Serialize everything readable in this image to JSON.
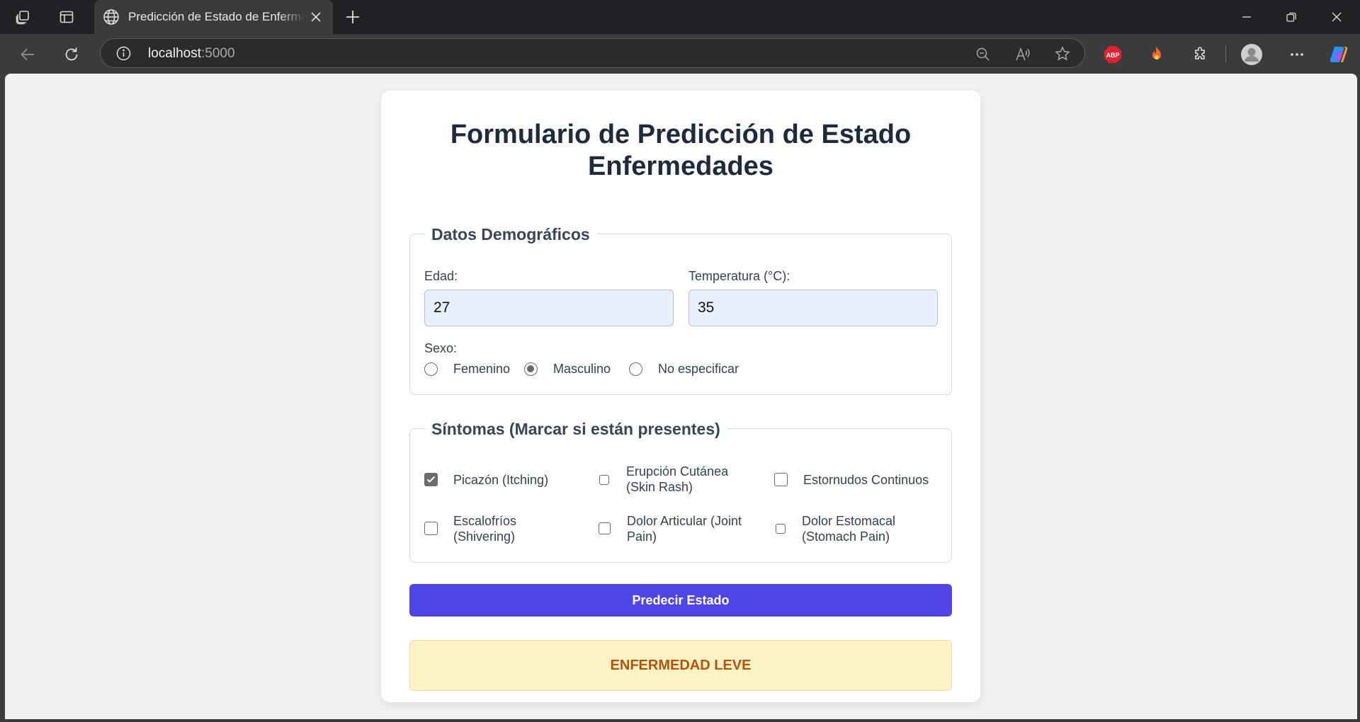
{
  "browser": {
    "tab_title": "Predicción de Estado de Enfermedades",
    "url_host": "localhost",
    "url_port": ":5000",
    "icons": [
      "workspaces-icon",
      "tab-actions-icon",
      "globe-icon",
      "close-icon",
      "new-tab-icon",
      "minimize-icon",
      "restore-icon",
      "window-close-icon",
      "back-icon",
      "refresh-icon",
      "site-info-icon",
      "zoom-out-icon",
      "read-aloud-icon",
      "favorite-icon",
      "adblock-icon",
      "extension-fire-icon",
      "extensions-icon",
      "profile-icon",
      "more-icon",
      "copilot-icon"
    ],
    "adblock_label": "ABP"
  },
  "form": {
    "title": "Formulario de Predicción de Estado Enfermedades",
    "demographics": {
      "legend": "Datos Demográficos",
      "age_label": "Edad:",
      "age_value": "27",
      "temp_label": "Temperatura (°C):",
      "temp_value": "35",
      "sex_label": "Sexo:",
      "sex_options": [
        {
          "label": "Femenino",
          "checked": false
        },
        {
          "label": "Masculino",
          "checked": true
        },
        {
          "label": "No especificar",
          "checked": false
        }
      ]
    },
    "symptoms": {
      "legend": "Síntomas (Marcar si están presentes)",
      "items": [
        {
          "label": "Picazón (Itching)",
          "checked": true
        },
        {
          "label": "Erupción Cutánea (Skin Rash)",
          "checked": false
        },
        {
          "label": "Estornudos Continuos",
          "checked": false
        },
        {
          "label": "Escalofríos (Shivering)",
          "checked": false
        },
        {
          "label": "Dolor Articular (Joint Pain)",
          "checked": false
        },
        {
          "label": "Dolor Estomacal (Stomach Pain)",
          "checked": false
        }
      ]
    },
    "submit_label": "Predecir Estado",
    "result": "ENFERMEDAD LEVE"
  },
  "colors": {
    "primary": "#4f46e5",
    "result_bg": "#fef3c7",
    "result_text": "#b45309",
    "input_bg": "#e8f0fe"
  }
}
